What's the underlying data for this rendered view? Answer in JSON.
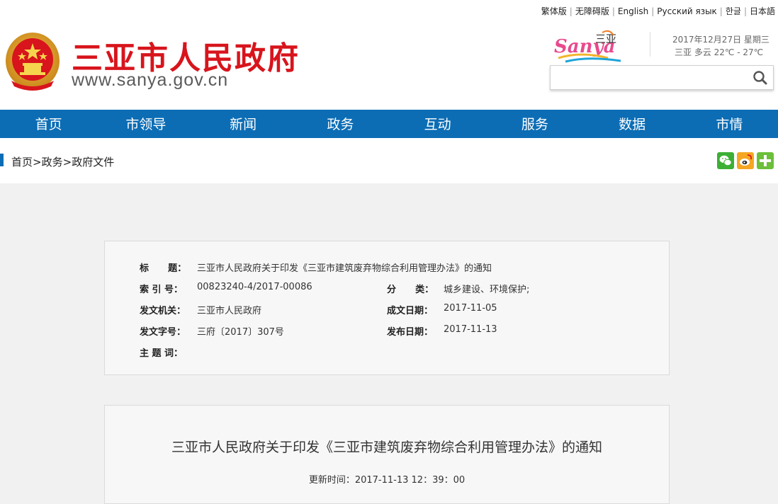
{
  "lang_links": [
    "繁体版",
    "无障碍版",
    "English",
    "Русский язык",
    "한글",
    "日本語"
  ],
  "site": {
    "title": "三亚市人民政府",
    "url": "www.sanya.gov.cn",
    "logo_text": "Sanya",
    "logo_cn": "三亚"
  },
  "date": {
    "line1": "2017年12月27日 星期三",
    "line2": "三亚  多云  22℃ - 27℃"
  },
  "search": {
    "value": "",
    "placeholder": ""
  },
  "nav": [
    "首页",
    "市领导",
    "新闻",
    "政务",
    "互动",
    "服务",
    "数据",
    "市情"
  ],
  "breadcrumb": [
    "首页",
    "政务",
    "政府文件"
  ],
  "breadcrumb_sep": ">",
  "meta": {
    "title_label": "标      题：",
    "title_value": "三亚市人民政府关于印发《三亚市建筑废弃物综合利用管理办法》的通知",
    "index_label": "索 引 号：",
    "index_value": "00823240-4/2017-00086",
    "category_label": "分      类：",
    "category_value": "城乡建设、环境保护;",
    "issuer_label": "发文机关：",
    "issuer_value": "三亚市人民政府",
    "written_label": "成文日期：",
    "written_value": "2017-11-05",
    "docno_label": "发文字号：",
    "docno_value": "三府〔2017〕307号",
    "published_label": "发布日期：",
    "published_value": "2017-11-13",
    "keywords_label": "主 题 词："
  },
  "article": {
    "title": "三亚市人民政府关于印发《三亚市建筑废弃物综合利用管理办法》的通知",
    "update": "更新时间：2017-11-13 12：39：00"
  },
  "colors": {
    "nav_blue": "#0c6db5",
    "title_red": "#d8141c"
  }
}
